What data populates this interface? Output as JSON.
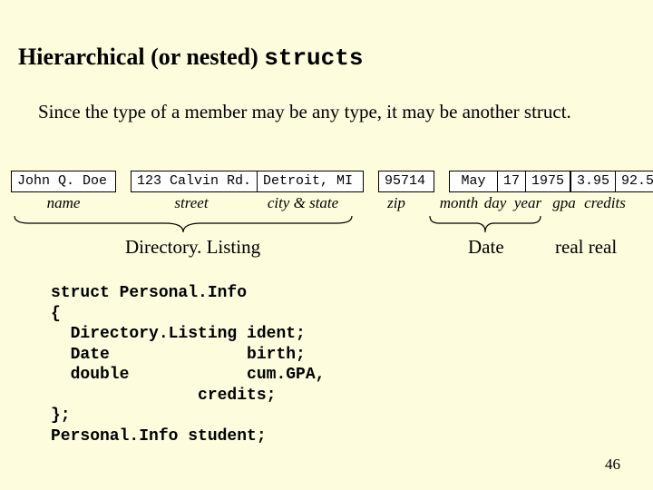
{
  "title": {
    "prefix": "Hierarchical (or nested) ",
    "mono": "structs"
  },
  "para": "Since the type of a member may be any type, it may be another struct.",
  "row": {
    "name": "John Q. Doe",
    "street": "123 Calvin Rd.",
    "citystate": "Detroit, MI",
    "zip": "95714",
    "month": "May",
    "day": "17",
    "year": "1975",
    "gpa": "3.95",
    "credits": "92.5"
  },
  "labels": {
    "name": "name",
    "street": "street",
    "citystate": "city & state",
    "zip": "zip",
    "month": "month",
    "day": "day",
    "year": "year",
    "gpa": "gpa",
    "credits": "credits"
  },
  "groups": {
    "dir": "Directory. Listing",
    "date": "Date",
    "reals": "real real"
  },
  "code": "struct Personal.Info\n{\n  Directory.Listing ident;\n  Date              birth;\n  double            cum.GPA,\n               credits;\n};\nPersonal.Info student;",
  "page": "46"
}
